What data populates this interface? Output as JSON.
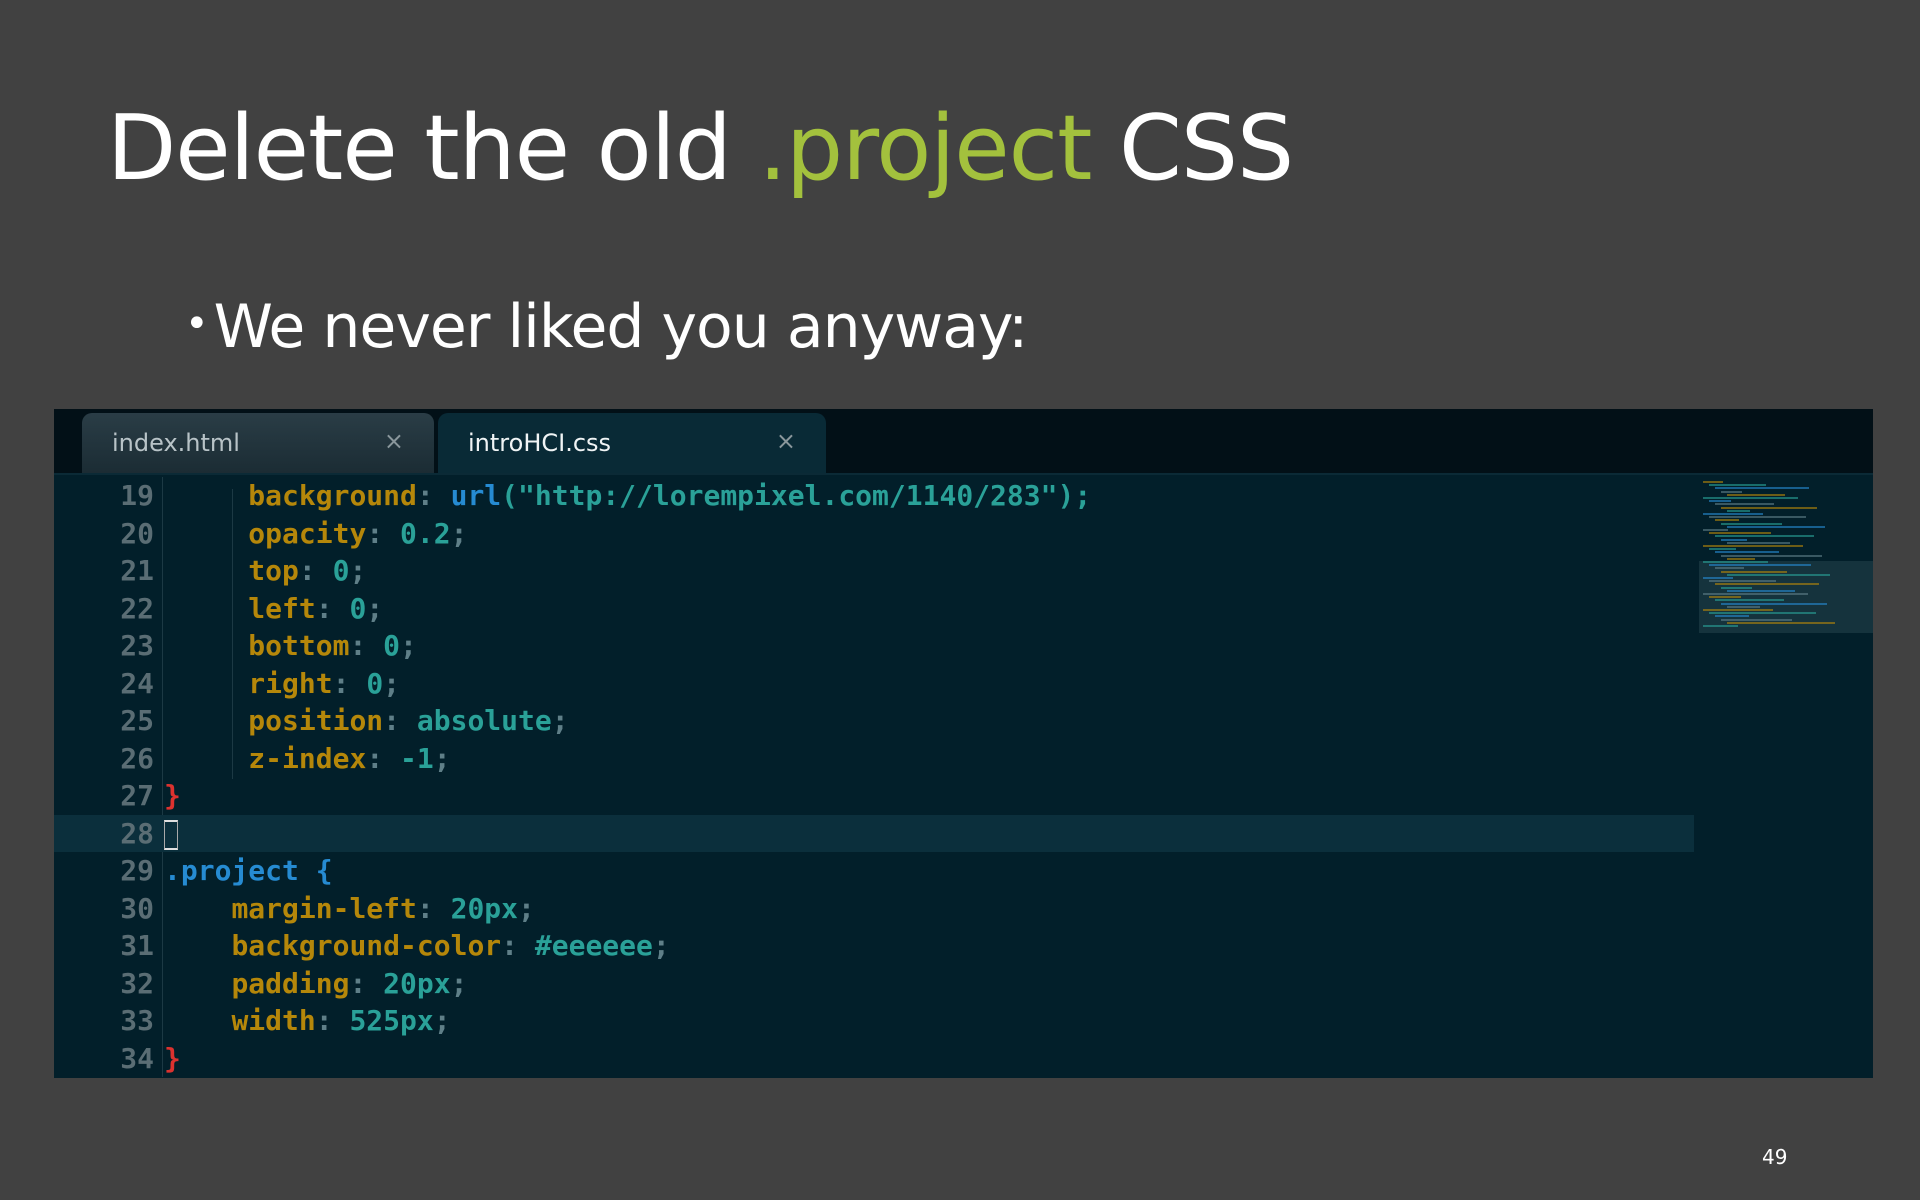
{
  "slide": {
    "title_prefix": "Delete the old ",
    "title_accent": ".project",
    "title_suffix": " CSS",
    "bullet_marker": "•",
    "bullet": "We never liked you anyway:",
    "page_number": "49",
    "accent_color": "#a3c13d",
    "background_color": "#414141"
  },
  "editor": {
    "tabs": [
      {
        "label": "index.html",
        "close_icon": "×",
        "active": false
      },
      {
        "label": "introHCI.css",
        "close_icon": "×",
        "active": true
      }
    ],
    "theme": {
      "background": "#021f2a",
      "property": "#b5870a",
      "value": "#2aa198",
      "selector": "#268bd2",
      "brace_close": "#dc322f",
      "punct": "#5f7f88",
      "line_number": "#5a6d74"
    },
    "lines": [
      {
        "num": "19",
        "indent": "     ",
        "tokens": [
          {
            "t": "background",
            "c": "property"
          },
          {
            "t": ": ",
            "c": "punct"
          },
          {
            "t": "url",
            "c": "selector"
          },
          {
            "t": "(\"http://lorempixel.com/1140/283\");",
            "c": "value"
          }
        ]
      },
      {
        "num": "20",
        "indent": "     ",
        "tokens": [
          {
            "t": "opacity",
            "c": "property"
          },
          {
            "t": ": ",
            "c": "punct"
          },
          {
            "t": "0.2",
            "c": "value"
          },
          {
            "t": ";",
            "c": "punct"
          }
        ]
      },
      {
        "num": "21",
        "indent": "     ",
        "tokens": [
          {
            "t": "top",
            "c": "property"
          },
          {
            "t": ": ",
            "c": "punct"
          },
          {
            "t": "0",
            "c": "value"
          },
          {
            "t": ";",
            "c": "punct"
          }
        ]
      },
      {
        "num": "22",
        "indent": "     ",
        "tokens": [
          {
            "t": "left",
            "c": "property"
          },
          {
            "t": ": ",
            "c": "punct"
          },
          {
            "t": "0",
            "c": "value"
          },
          {
            "t": ";",
            "c": "punct"
          }
        ]
      },
      {
        "num": "23",
        "indent": "     ",
        "tokens": [
          {
            "t": "bottom",
            "c": "property"
          },
          {
            "t": ": ",
            "c": "punct"
          },
          {
            "t": "0",
            "c": "value"
          },
          {
            "t": ";",
            "c": "punct"
          }
        ]
      },
      {
        "num": "24",
        "indent": "     ",
        "tokens": [
          {
            "t": "right",
            "c": "property"
          },
          {
            "t": ": ",
            "c": "punct"
          },
          {
            "t": "0",
            "c": "value"
          },
          {
            "t": ";",
            "c": "punct"
          }
        ]
      },
      {
        "num": "25",
        "indent": "     ",
        "tokens": [
          {
            "t": "position",
            "c": "property"
          },
          {
            "t": ": ",
            "c": "punct"
          },
          {
            "t": "absolute",
            "c": "value"
          },
          {
            "t": ";",
            "c": "punct"
          }
        ]
      },
      {
        "num": "26",
        "indent": "     ",
        "tokens": [
          {
            "t": "z-index",
            "c": "property"
          },
          {
            "t": ": ",
            "c": "punct"
          },
          {
            "t": "-1",
            "c": "value"
          },
          {
            "t": ";",
            "c": "punct"
          }
        ]
      },
      {
        "num": "27",
        "indent": "",
        "tokens": [
          {
            "t": "}",
            "c": "brace_close"
          }
        ]
      },
      {
        "num": "28",
        "indent": "",
        "tokens": [],
        "current": true,
        "cursor": true
      },
      {
        "num": "29",
        "indent": "",
        "tokens": [
          {
            "t": ".project",
            "c": "selector"
          },
          {
            "t": " {",
            "c": "selector"
          }
        ]
      },
      {
        "num": "30",
        "indent": "    ",
        "tokens": [
          {
            "t": "margin-left",
            "c": "property"
          },
          {
            "t": ": ",
            "c": "punct"
          },
          {
            "t": "20px",
            "c": "value"
          },
          {
            "t": ";",
            "c": "punct"
          }
        ]
      },
      {
        "num": "31",
        "indent": "    ",
        "tokens": [
          {
            "t": "background-color",
            "c": "property"
          },
          {
            "t": ": ",
            "c": "punct"
          },
          {
            "t": "#eeeeee",
            "c": "value"
          },
          {
            "t": ";",
            "c": "punct"
          }
        ]
      },
      {
        "num": "32",
        "indent": "    ",
        "tokens": [
          {
            "t": "padding",
            "c": "property"
          },
          {
            "t": ": ",
            "c": "punct"
          },
          {
            "t": "20px",
            "c": "value"
          },
          {
            "t": ";",
            "c": "punct"
          }
        ]
      },
      {
        "num": "33",
        "indent": "    ",
        "tokens": [
          {
            "t": "width",
            "c": "property"
          },
          {
            "t": ": ",
            "c": "punct"
          },
          {
            "t": "525px",
            "c": "value"
          },
          {
            "t": ";",
            "c": "punct"
          }
        ]
      },
      {
        "num": "34",
        "indent": "",
        "tokens": [
          {
            "t": "}",
            "c": "brace_close"
          }
        ]
      }
    ]
  }
}
